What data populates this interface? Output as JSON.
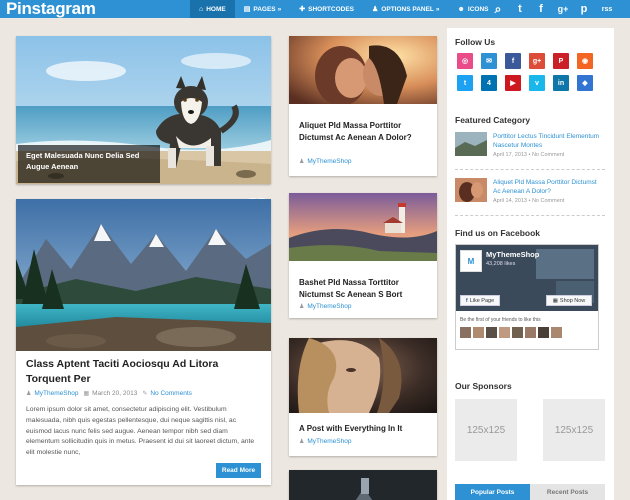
{
  "brand": {
    "logo": "Pinstagram",
    "accent": "#2d91d3"
  },
  "nav": {
    "items": [
      {
        "label": "Home",
        "icon": "home-icon",
        "active": true
      },
      {
        "label": "Pages",
        "icon": "pages-icon",
        "chevron": "»"
      },
      {
        "label": "Shortcodes",
        "icon": "plus-icon"
      },
      {
        "label": "Options Panel",
        "icon": "person-icon",
        "chevron": "»"
      },
      {
        "label": "Icons",
        "icon": "user-icon"
      }
    ],
    "search_glyph": "⌕",
    "social": [
      "t",
      "f",
      "g+",
      "p",
      "rss"
    ]
  },
  "posts": {
    "husky": {
      "caption": "Eget Malesuada Nunc Delia Sed Augue Aenean"
    },
    "lake": {
      "title": "Class Aptent Taciti Aociosqu Ad Litora Torquent Per",
      "author": "MyThemeShop",
      "date": "March 20, 2013",
      "comments": "No Comments",
      "excerpt": "Lorem ipsum dolor sit amet, consectetur adipiscing elit. Vestibulum malesuada, nibh quis egestas pellentesque, dui neque sagittis nisl, ac euismod lacus nunc felis sed augue. Aenean tempor nibh sed diam elementum sollicitudin quis in metus. Praesent id dui sit laoreet dictum, ante elit molestie nunc,",
      "more": "Read More"
    },
    "kiss": {
      "title": "Aliquet Pld Massa Porttitor Dictumst Ac Aenean A Dolor?",
      "author": "MyThemeShop"
    },
    "lighthouse": {
      "title": "Bashet Pld Nassa Torttitor Nictumst Sc Aenean S Bort",
      "author": "MyThemeShop"
    },
    "woman": {
      "title": "A Post with Everything In It",
      "author": "MyThemeShop"
    }
  },
  "sidebar": {
    "follow_title": "Follow Us",
    "social_icons": [
      {
        "name": "dribbble",
        "glyph": "◎",
        "color": "#ea4c89"
      },
      {
        "name": "email",
        "glyph": "✉",
        "color": "#2d91d3"
      },
      {
        "name": "facebook",
        "glyph": "f",
        "color": "#3b5998"
      },
      {
        "name": "google-plus",
        "glyph": "g+",
        "color": "#dd4b39"
      },
      {
        "name": "pinterest",
        "glyph": "P",
        "color": "#cb2027"
      },
      {
        "name": "rss",
        "glyph": "◉",
        "color": "#f26522"
      },
      {
        "name": "twitter",
        "glyph": "t",
        "color": "#1da1f2"
      },
      {
        "name": "foursquare",
        "glyph": "4",
        "color": "#0072b1"
      },
      {
        "name": "youtube",
        "glyph": "▶",
        "color": "#cc181e"
      },
      {
        "name": "vimeo",
        "glyph": "v",
        "color": "#1ab7ea"
      },
      {
        "name": "linkedin",
        "glyph": "in",
        "color": "#0e76a8"
      },
      {
        "name": "delicious",
        "glyph": "◆",
        "color": "#3274d1"
      }
    ],
    "featured_title": "Featured Category",
    "featured": [
      {
        "title": "Porttitor Lectus Tincidunt Elementum Nascetur Montes",
        "date": "April 17, 2013",
        "comments": "No Comment"
      },
      {
        "title": "Aliquet Pld Massa Porttitor Dictumst Ac Aenean A Dolor?",
        "date": "April 14, 2013",
        "comments": "No Comment"
      }
    ],
    "facebook_title": "Find us on Facebook",
    "facebook": {
      "page_name": "MyThemeShop",
      "likes": "43,208 likes",
      "like_button": "Like Page",
      "shop_button": "Shop Now",
      "fans_text": "Be the first of your friends to like this"
    },
    "sponsors_title": "Our Sponsors",
    "ads": [
      "125x125",
      "125x125"
    ],
    "tabs": [
      "Popular Posts",
      "Recent Posts"
    ]
  }
}
